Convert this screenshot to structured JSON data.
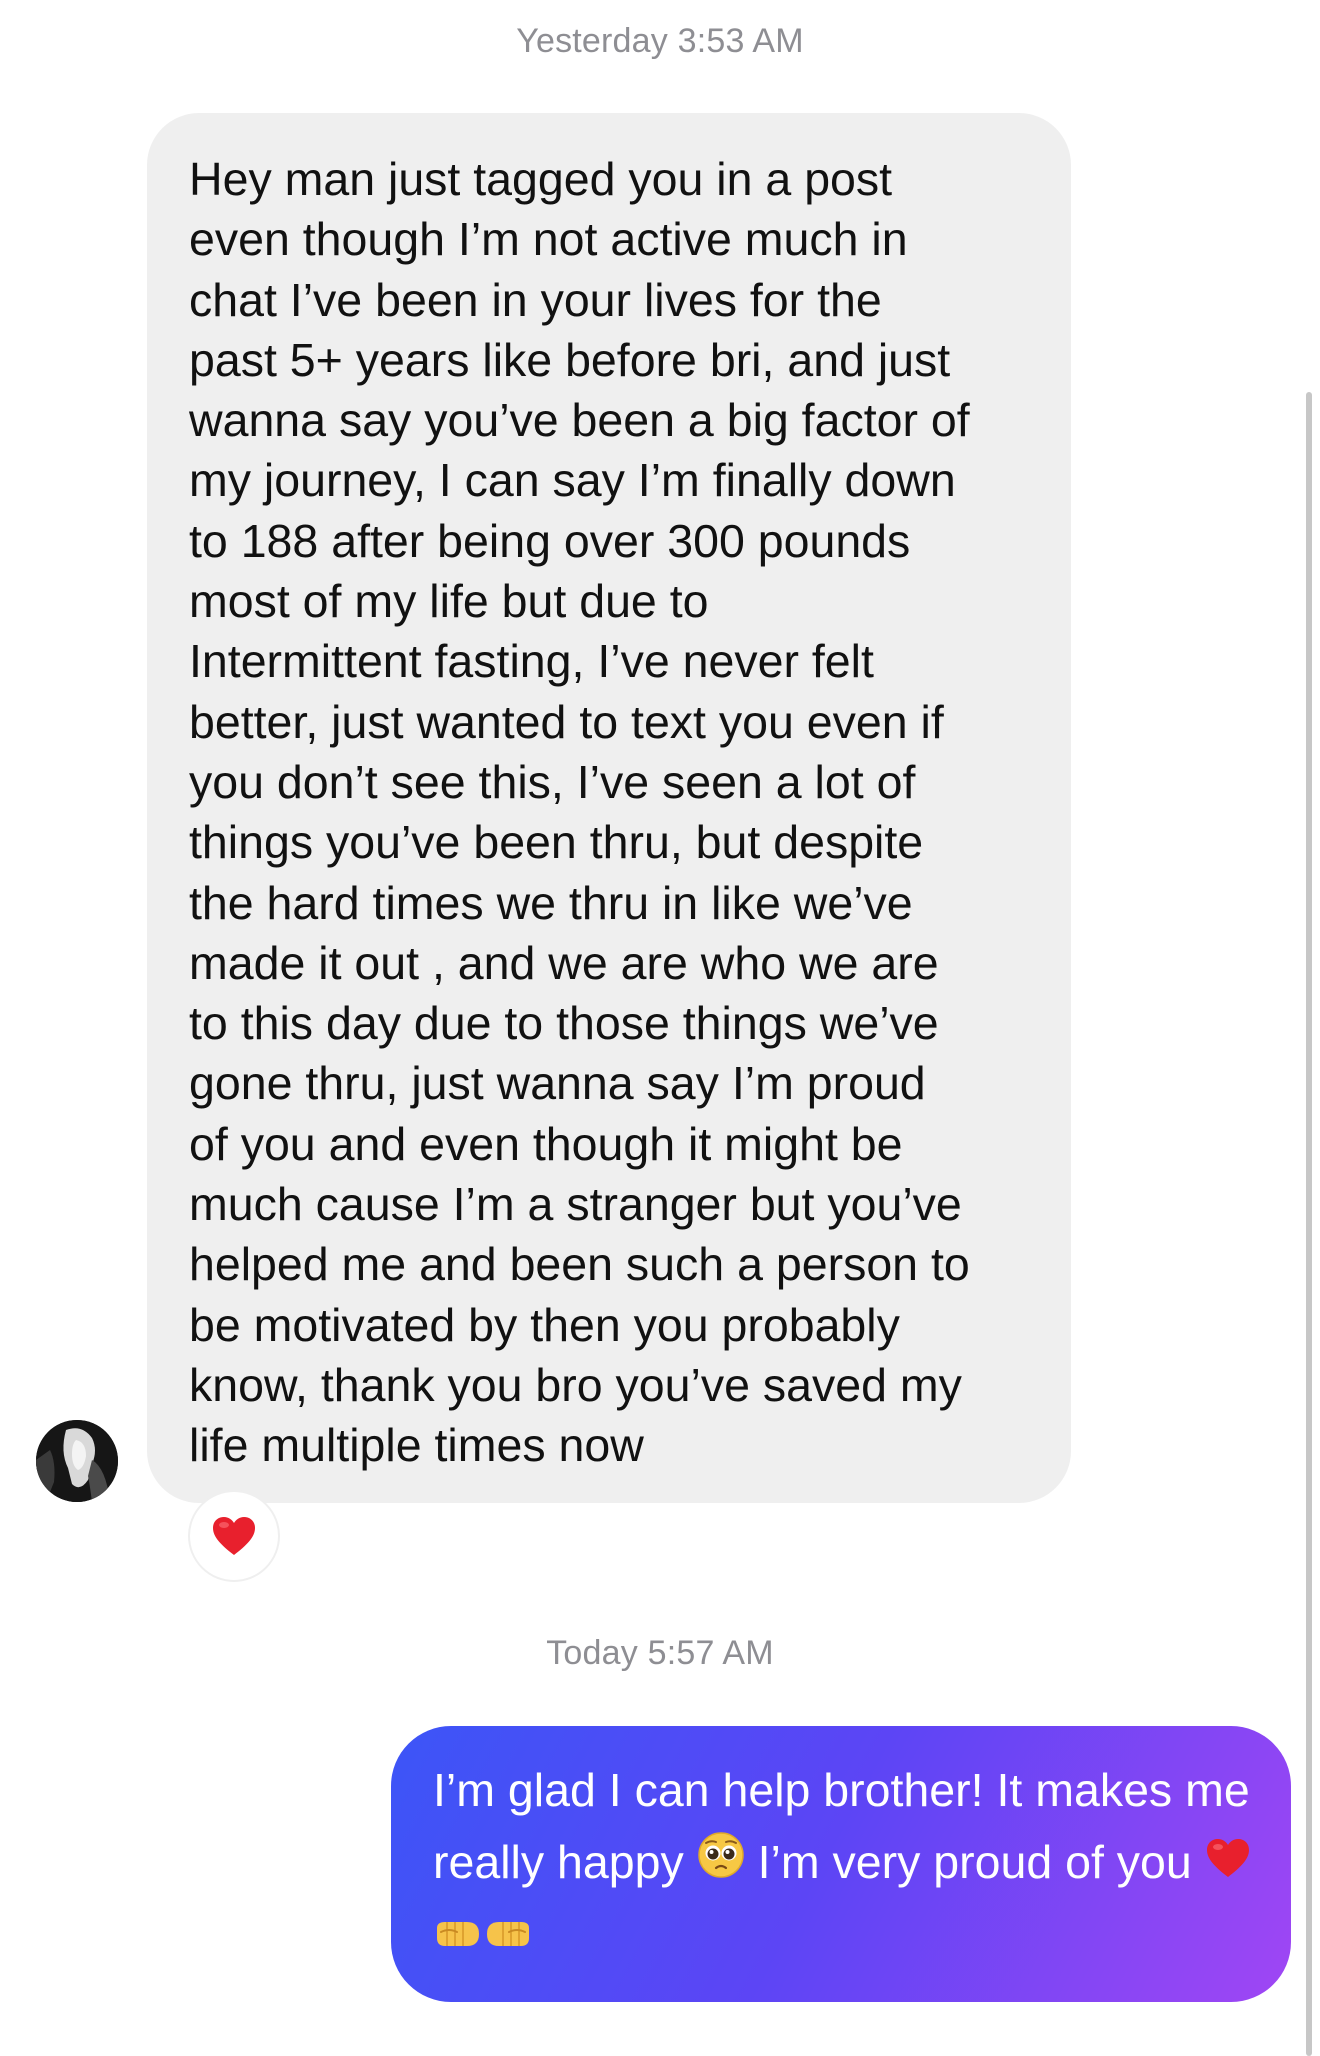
{
  "timestamps": [
    "Yesterday 3:53 AM",
    "Today 5:57 AM"
  ],
  "incoming": {
    "text": "Hey man just tagged you in a post\neven though I’m not active much in\nchat I’ve been in your lives for the\npast 5+ years like before bri,  and just\nwanna say you’ve been a big factor of\nmy journey, I can say I’m finally down\nto 188 after being over 300 pounds\nmost of my life but due to\nIntermittent fasting,  I’ve never felt\nbetter, just wanted to text you even if\nyou don’t see this, I’ve seen a lot of\nthings you’ve been thru, but despite\nthe hard times we thru in like we’ve\nmade it out , and we are who we are\nto this day due to those things we’ve\ngone thru, just wanna say I’m proud\nof you and even though it might be\nmuch cause I’m a stranger but you’ve\nhelped me and been such a person to\nbe motivated by then you probably\nknow, thank you bro you’ve saved my\nlife multiple times now",
    "reaction_icon": "red-heart"
  },
  "outgoing": {
    "text_1": "I’m glad I can help brother! It makes me really happy",
    "text_2": "I’m very proud of you",
    "emojis": [
      "pleading-face",
      "red-heart",
      "left-fist",
      "right-fist"
    ]
  },
  "colors": {
    "incoming_bubble": "#efefef",
    "outgoing_gradient_start": "#3c55f7",
    "outgoing_gradient_end": "#a046f4",
    "timestamp": "#8e8e93"
  }
}
